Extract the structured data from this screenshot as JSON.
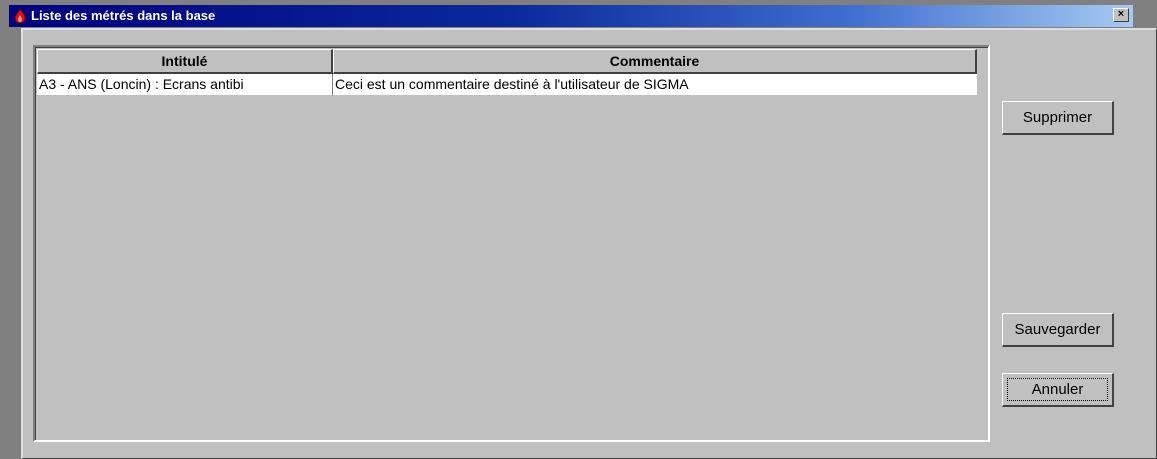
{
  "window": {
    "title": "Liste des métrés dans la base",
    "close_glyph": "×",
    "icon": "red-flame-app-icon"
  },
  "table": {
    "columns": [
      "Intitulé",
      "Commentaire"
    ],
    "rows": [
      {
        "intitule": "A3 - ANS (Loncin) : Ecrans antibi",
        "commentaire": "Ceci est un commentaire destiné à l'utilisateur de SIGMA"
      }
    ]
  },
  "buttons": {
    "supprimer": "Supprimer",
    "sauvegarder": "Sauvegarder",
    "annuler": "Annuler"
  },
  "colors": {
    "title_active_start": "#000080",
    "title_active_end": "#a6caf0",
    "face": "#c0c0c0",
    "desktop": "#808080"
  }
}
